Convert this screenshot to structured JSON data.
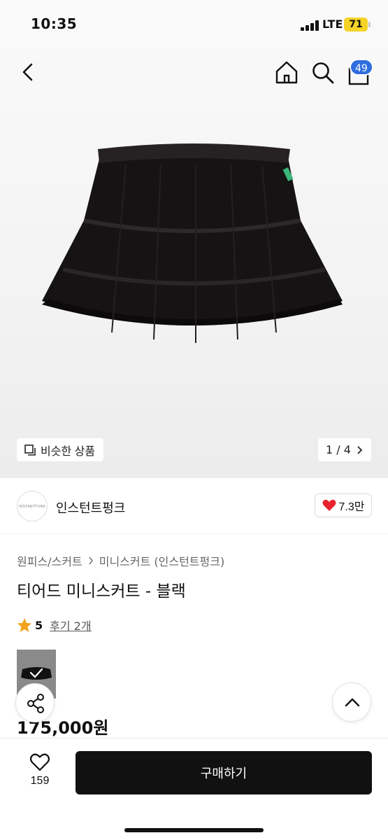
{
  "status": {
    "time": "10:35",
    "network": "LTE",
    "battery": "71"
  },
  "nav": {
    "cart_count": "49",
    "back_icon": "chevron-left-icon",
    "home_icon": "home-icon",
    "search_icon": "search-icon",
    "cart_icon": "shopping-bag-icon"
  },
  "gallery": {
    "similar_label": "비슷한 상품",
    "pager": "1 / 4"
  },
  "shop": {
    "logo_text": "INSTANTFUNK",
    "name": "인스턴트펑크",
    "likes": "7.3만"
  },
  "product": {
    "breadcrumb": [
      "원피스/스커트",
      "미니스커트 (인스턴트펑크)"
    ],
    "title": "티어드 미니스커트 - 블랙",
    "rating": "5",
    "reviews": "후기 2개",
    "price": "175,000원"
  },
  "bottom": {
    "wish_count": "159",
    "buy_label": "구매하기"
  },
  "colors": {
    "accent": "#2f6ddf",
    "battery": "#f5d327",
    "heart": "#e8232e",
    "star": "#f2a21b",
    "buy": "#111111"
  }
}
